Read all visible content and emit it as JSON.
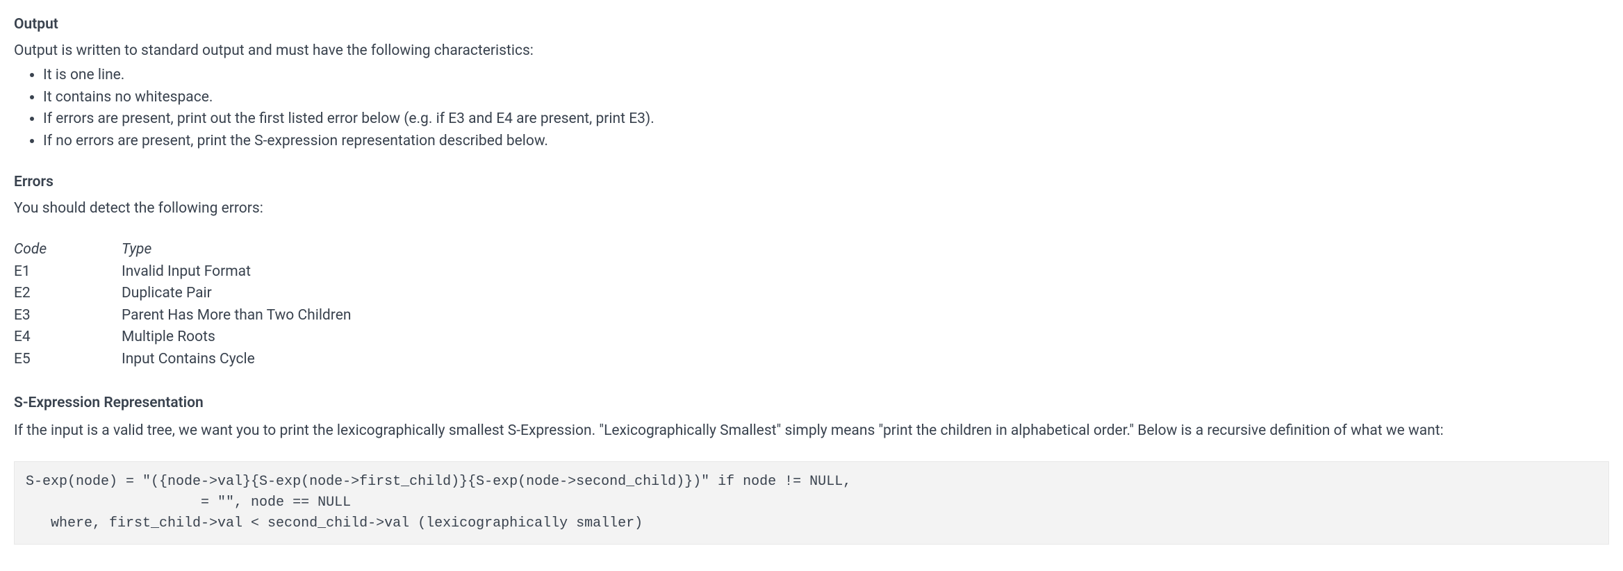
{
  "output": {
    "heading": "Output",
    "intro": "Output is written to standard output and must have the following characteristics:",
    "bullets": [
      "It is one line.",
      "It contains no whitespace.",
      "If errors are present, print out the first listed error below (e.g. if E3 and E4 are present, print E3).",
      "If no errors are present, print the S-expression representation described below."
    ]
  },
  "errors": {
    "heading": "Errors",
    "intro": "You should detect the following errors:",
    "header": {
      "code": "Code",
      "type": "Type"
    },
    "rows": [
      {
        "code": "E1",
        "type": "Invalid Input Format"
      },
      {
        "code": "E2",
        "type": "Duplicate Pair"
      },
      {
        "code": "E3",
        "type": "Parent Has More than Two Children"
      },
      {
        "code": "E4",
        "type": "Multiple Roots"
      },
      {
        "code": "E5",
        "type": "Input Contains Cycle"
      }
    ]
  },
  "sexp": {
    "heading": "S-Expression Representation",
    "intro": "If the input is a valid tree, we want you to print the lexicographically smallest S-Expression. \"Lexicographically Smallest\" simply means \"print the children in alphabetical order.\" Below is a recursive definition of what we want:",
    "code": "S-exp(node) = \"({node->val}{S-exp(node->first_child)}{S-exp(node->second_child)})\" if node != NULL,\n                     = \"\", node == NULL\n   where, first_child->val < second_child->val (lexicographically smaller)"
  }
}
